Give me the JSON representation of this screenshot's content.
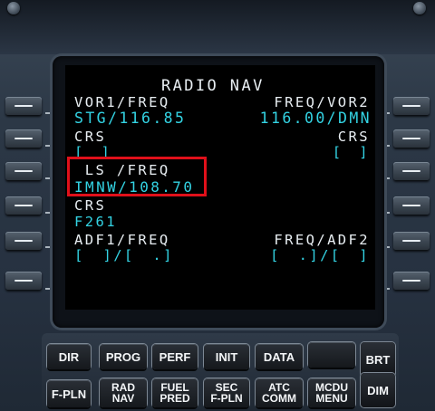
{
  "screen": {
    "title": "RADIO NAV",
    "vor1_label": "VOR1/FREQ",
    "vor1_value": "STG/116.85",
    "vor2_label": "FREQ/VOR2",
    "vor2_value": "116.00/DMN",
    "crs1_label": "CRS",
    "crs1_value": "[ ]",
    "crs2_label": "CRS",
    "crs2_value": "[ ]",
    "ls_label": " LS /FREQ",
    "ls_value": "IMNW/108.70",
    "ls_crs_label": "CRS",
    "ls_crs_value": "F261",
    "adf1_label": "ADF1/FREQ",
    "adf1_value": "[ ]/[ .]",
    "adf2_label": "FREQ/ADF2",
    "adf2_value": "[ .]/[ ]"
  },
  "keys": {
    "dir": "DIR",
    "prog": "PROG",
    "perf": "PERF",
    "init": "INIT",
    "data": "DATA",
    "brt": "BRT",
    "fpln": "F-PLN",
    "rad_nav_1": "RAD",
    "rad_nav_2": "NAV",
    "fuel_pred_1": "FUEL",
    "fuel_pred_2": "PRED",
    "sec_fpln_1": "SEC",
    "sec_fpln_2": "F-PLN",
    "atc_comm_1": "ATC",
    "atc_comm_2": "COMM",
    "mcdu_menu_1": "MCDU",
    "mcdu_menu_2": "MENU",
    "dim": "DIM"
  },
  "colors": {
    "label_white": "#e8eef2",
    "data_cyan": "#33d3e3",
    "highlight_red": "#e0101a"
  }
}
